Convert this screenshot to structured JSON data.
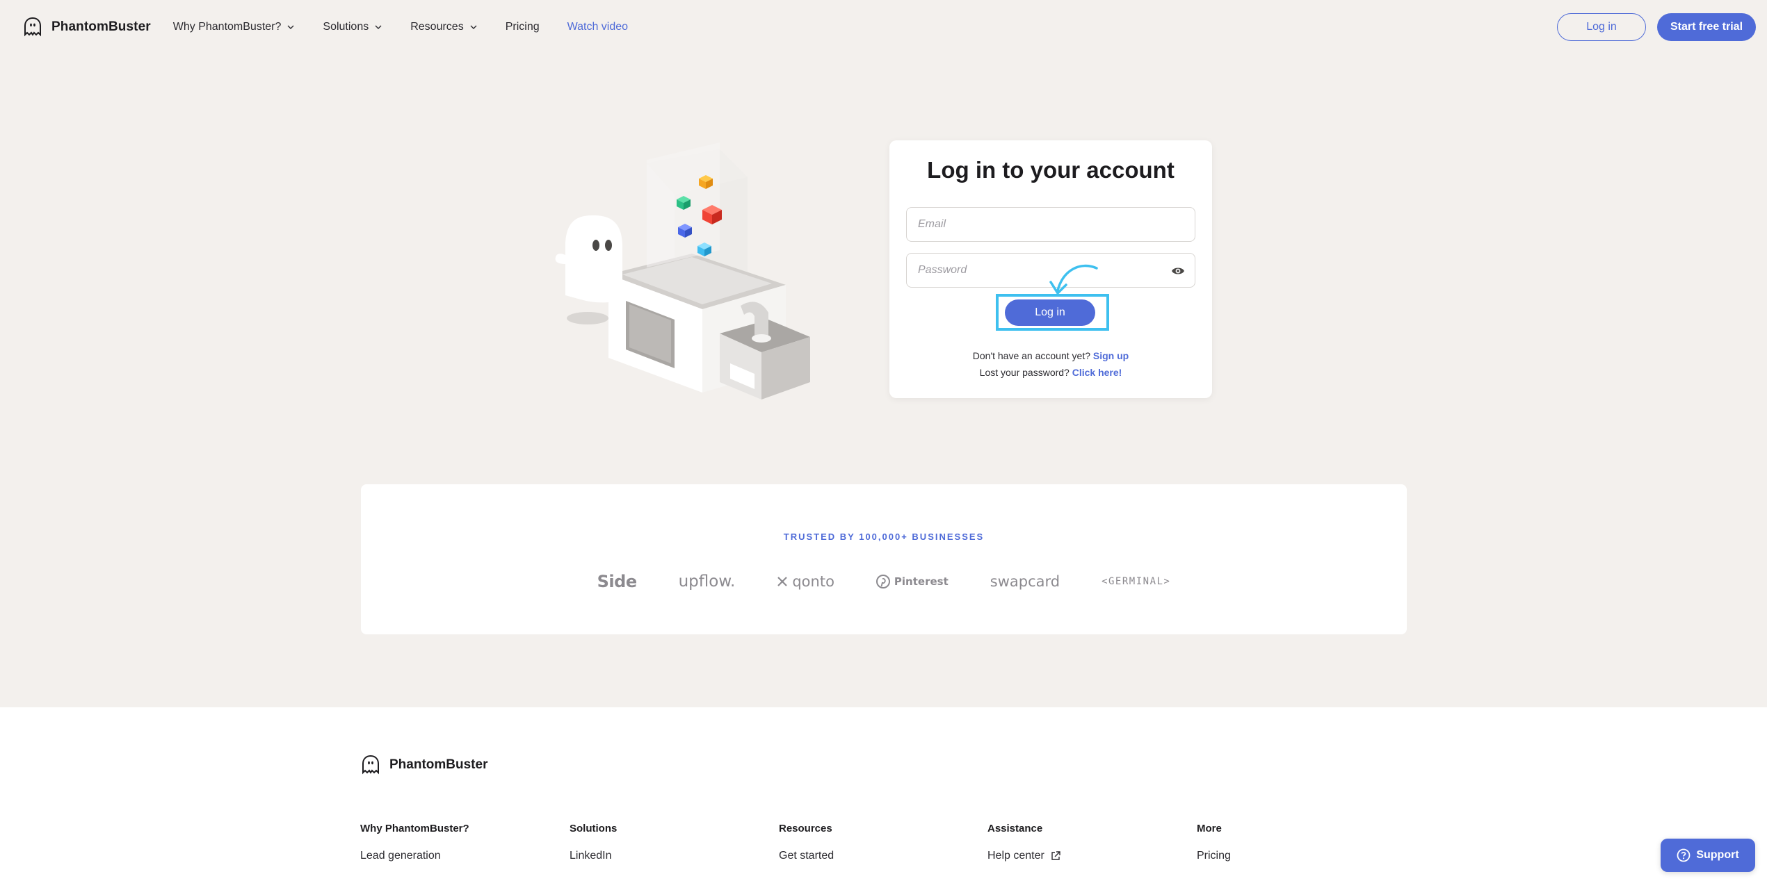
{
  "header": {
    "brand": "PhantomBuster",
    "nav": [
      {
        "label": "Why PhantomBuster?",
        "dropdown": true
      },
      {
        "label": "Solutions",
        "dropdown": true
      },
      {
        "label": "Resources",
        "dropdown": true
      },
      {
        "label": "Pricing",
        "dropdown": false
      },
      {
        "label": "Watch video",
        "dropdown": false
      }
    ],
    "login_label": "Log in",
    "trial_label": "Start free trial"
  },
  "login_card": {
    "title": "Log in to your account",
    "email_placeholder": "Email",
    "password_placeholder": "Password",
    "submit_label": "Log in",
    "signup_prompt": "Don't have an account yet?",
    "signup_link": "Sign up",
    "forgot_prompt": "Lost your password?",
    "forgot_link": "Click here!"
  },
  "trusted": {
    "title": "TRUSTED BY 100,000+ BUSINESSES",
    "logos": [
      "Side",
      "upflow.",
      "qonto",
      "Pinterest",
      "swapcard",
      "<GERMINAL>"
    ]
  },
  "footer": {
    "brand": "PhantomBuster",
    "columns": [
      {
        "title": "Why PhantomBuster?",
        "link": "Lead generation"
      },
      {
        "title": "Solutions",
        "link": "LinkedIn"
      },
      {
        "title": "Resources",
        "link": "Get started"
      },
      {
        "title": "Assistance",
        "link": "Help center"
      },
      {
        "title": "More",
        "link": "Pricing"
      }
    ]
  },
  "support_label": "Support",
  "colors": {
    "accent": "#4f6bd8",
    "background": "#f3f0ed",
    "highlight": "#3ec0ef"
  }
}
